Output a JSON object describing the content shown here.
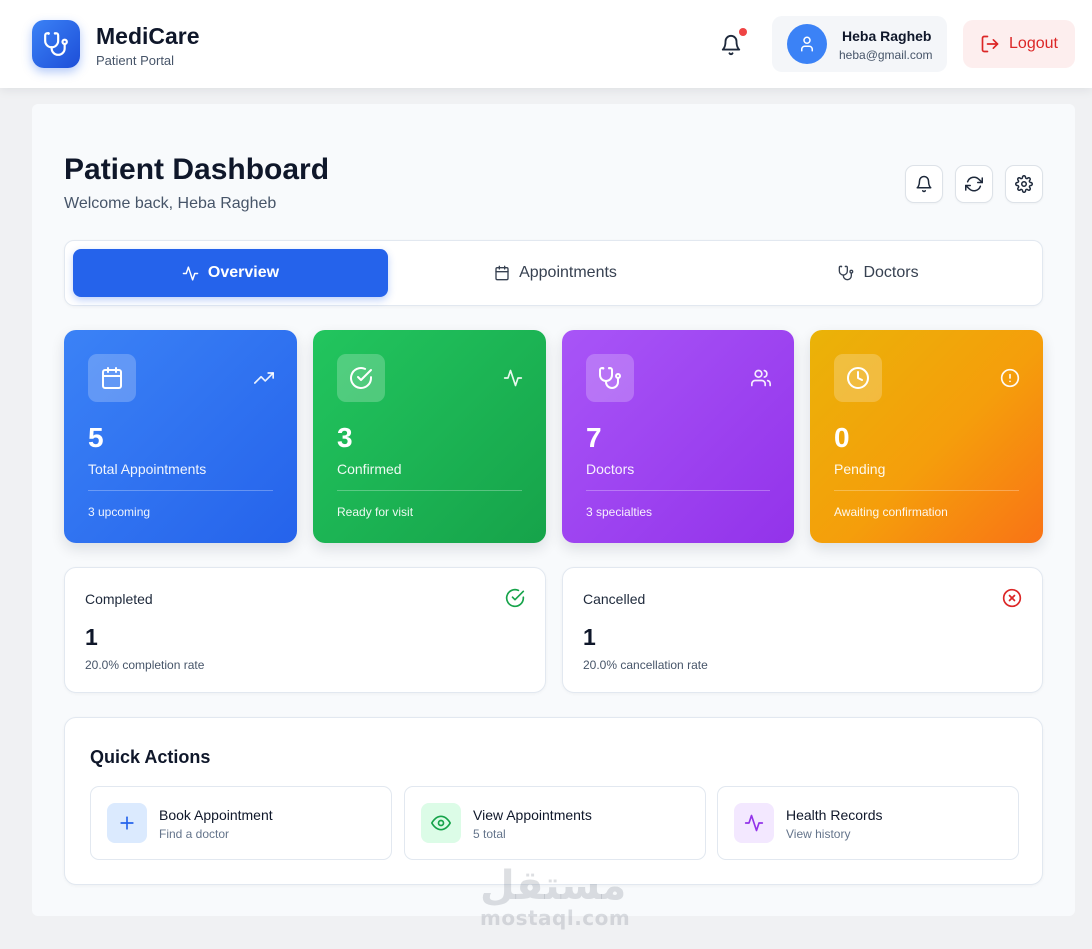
{
  "app": {
    "name": "MediCare",
    "subtitle": "Patient Portal",
    "logo_icon": "stethoscope-icon",
    "accent": "#2563eb"
  },
  "nav": {
    "notifications_icon": "bell-icon",
    "has_unread": true,
    "user": {
      "name": "Heba Ragheb",
      "email": "heba@gmail.com",
      "avatar_icon": "user-icon"
    },
    "logout_label": "Logout"
  },
  "page": {
    "title": "Patient Dashboard",
    "welcome": "Welcome back, Heba Ragheb",
    "toolbar": [
      "bell-icon",
      "refresh-icon",
      "settings-icon"
    ]
  },
  "tabs": [
    {
      "label": "Overview",
      "icon": "activity-icon",
      "active": true
    },
    {
      "label": "Appointments",
      "icon": "calendar-icon",
      "active": false
    },
    {
      "label": "Doctors",
      "icon": "stethoscope-icon",
      "active": false
    }
  ],
  "stats": [
    {
      "value": "5",
      "label": "Total Appointments",
      "note": "3 upcoming",
      "icon": "calendar-icon",
      "corner_icon": "trending-up-icon",
      "color": "#3b82f6"
    },
    {
      "value": "3",
      "label": "Confirmed",
      "note": "Ready for visit",
      "icon": "check-circle-icon",
      "corner_icon": "activity-icon",
      "color": "#22c55e"
    },
    {
      "value": "7",
      "label": "Doctors",
      "note": "3 specialties",
      "icon": "stethoscope-icon",
      "corner_icon": "users-icon",
      "color": "#a855f7"
    },
    {
      "value": "0",
      "label": "Pending",
      "note": "Awaiting confirmation",
      "icon": "clock-icon",
      "corner_icon": "alert-circle-icon",
      "color": "#f59e0b"
    }
  ],
  "summary": [
    {
      "title": "Completed",
      "value": "1",
      "note": "20.0% completion rate",
      "icon": "check-circle-icon",
      "color": "#16a34a"
    },
    {
      "title": "Cancelled",
      "value": "1",
      "note": "20.0% cancellation rate",
      "icon": "x-circle-icon",
      "color": "#dc2626"
    }
  ],
  "quick_actions": {
    "title": "Quick Actions",
    "items": [
      {
        "title": "Book Appointment",
        "subtitle": "Find a doctor",
        "icon": "plus-icon",
        "color": "#2563eb"
      },
      {
        "title": "View Appointments",
        "subtitle": "5 total",
        "icon": "eye-icon",
        "color": "#16a34a"
      },
      {
        "title": "Health Records",
        "subtitle": "View history",
        "icon": "activity-icon",
        "color": "#9333ea"
      }
    ]
  },
  "watermark": {
    "arabic": "مستقل",
    "latin": "mostaql.com"
  }
}
